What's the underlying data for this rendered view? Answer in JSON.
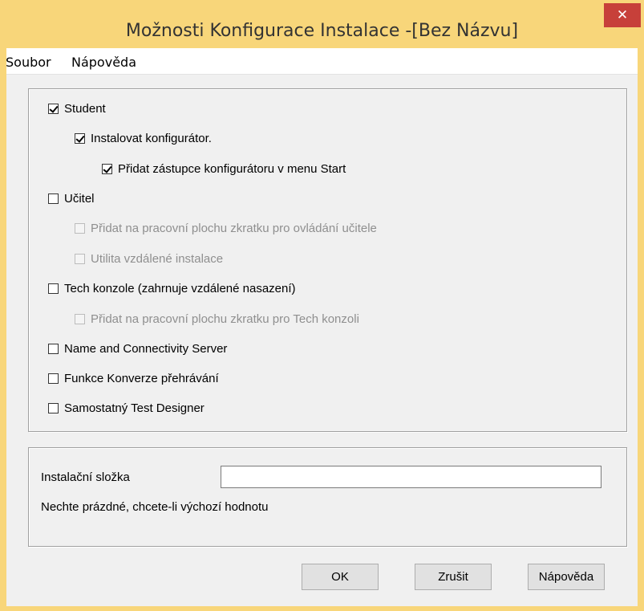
{
  "window": {
    "title": "Možnosti Konfigurace Instalace -[Bez Názvu]",
    "close_glyph": "✕",
    "accent_color": "#f8d67a",
    "close_color": "#c7403a"
  },
  "menu": {
    "file": "Soubor",
    "help": "Nápověda"
  },
  "options": [
    {
      "label": "Student",
      "checked": true,
      "enabled": true
    },
    {
      "label": "Instalovat konfigurátor.",
      "checked": true,
      "enabled": true
    },
    {
      "label": "Přidat zástupce konfigurátoru v menu Start",
      "checked": true,
      "enabled": true
    },
    {
      "label": "Učitel",
      "checked": false,
      "enabled": true
    },
    {
      "label": "Přidat na pracovní plochu zkratku pro ovládání učitele",
      "checked": false,
      "enabled": false
    },
    {
      "label": "Utilita vzdálené instalace",
      "checked": false,
      "enabled": false
    },
    {
      "label": "Tech konzole (zahrnuje vzdálené nasazení)",
      "checked": false,
      "enabled": true
    },
    {
      "label": "Přidat na pracovní plochu zkratku pro Tech konzoli",
      "checked": false,
      "enabled": false
    },
    {
      "label": "Name and Connectivity Server",
      "checked": false,
      "enabled": true
    },
    {
      "label": "Funkce Konverze přehrávání",
      "checked": false,
      "enabled": true
    },
    {
      "label": "Samostatný Test Designer",
      "checked": false,
      "enabled": true
    }
  ],
  "install_folder": {
    "label": "Instalační složka",
    "value": "",
    "hint": "Nechte prázdné, chcete-li výchozí hodnotu"
  },
  "buttons": {
    "ok": "OK",
    "cancel": "Zrušit",
    "help": "Nápověda"
  }
}
